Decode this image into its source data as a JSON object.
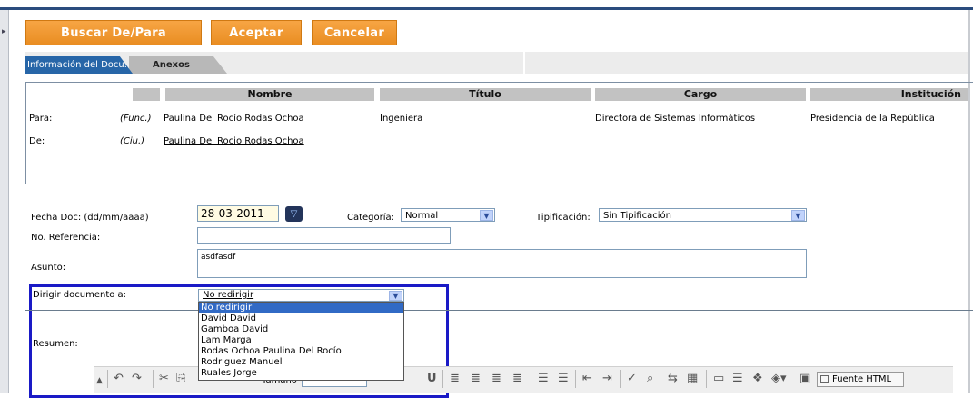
{
  "buttons": {
    "buscar": "Buscar De/Para",
    "aceptar": "Aceptar",
    "cancelar": "Cancelar"
  },
  "tabs": [
    {
      "label": "Información del Docu."
    },
    {
      "label": "Anexos"
    }
  ],
  "recipients": {
    "headers": [
      "Nombre",
      "Título",
      "Cargo",
      "Institución"
    ],
    "para": {
      "label": "Para:",
      "type": "(Func.)",
      "name": "Paulina Del Rocío Rodas Ochoa",
      "title": "Ingeniera",
      "cargo": "Directora de Sistemas Informáticos",
      "institucion": "Presidencia de la República"
    },
    "de": {
      "label": "De:",
      "type": "(Ciu.)",
      "name": "Paulina Del Rocio Rodas Ochoa"
    }
  },
  "form": {
    "fecha_label": "Fecha Doc: (dd/mm/aaaa)",
    "fecha_value": "28-03-2011",
    "categoria_label": "Categoría:",
    "categoria_value": "Normal",
    "tipificacion_label": "Tipificación:",
    "tipificacion_value": "Sin Tipificación",
    "referencia_label": "No. Referencia:",
    "referencia_value": "",
    "asunto_label": "Asunto:",
    "asunto_value": "asdfasdf",
    "dirigir_label": "Dirigir documento a:",
    "dirigir_value": "No redirigir",
    "resumen_label": "Resumen:"
  },
  "dropdown_options": [
    "No redirigir",
    "David David",
    "Gamboa David",
    "Lam Marga",
    "Rodas Ochoa Paulina Del Rocío",
    "Rodriguez Manuel",
    "Ruales Jorge"
  ],
  "toolbar": {
    "tamano_label": "Tamaño",
    "fuente_html": "Fuente HTML"
  }
}
